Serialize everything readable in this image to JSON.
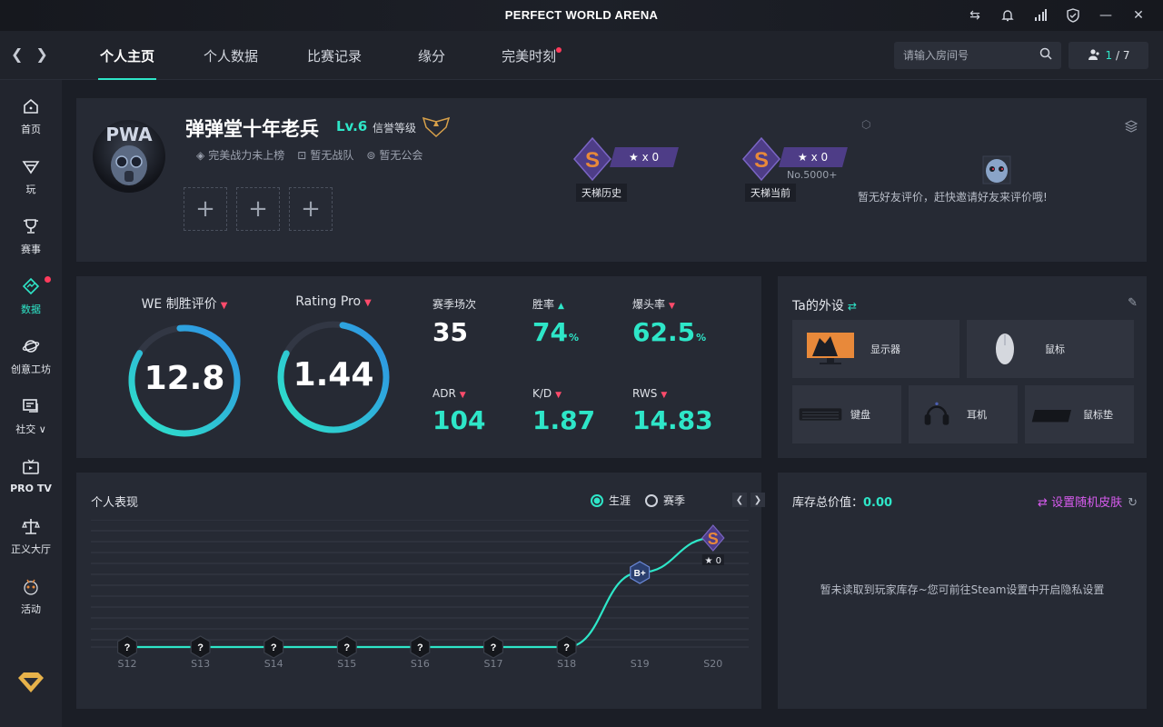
{
  "window": {
    "title": "PERFECT WORLD ARENA"
  },
  "nav": {
    "tabs": [
      {
        "label": "个人主页"
      },
      {
        "label": "个人数据"
      },
      {
        "label": "比赛记录"
      },
      {
        "label": "缘分"
      },
      {
        "label": "完美时刻"
      }
    ],
    "search_placeholder": "请输入房间号",
    "room_current": "1",
    "room_total": "/ 7"
  },
  "sidebar": {
    "items": [
      {
        "label": "首页",
        "icon": "home-icon"
      },
      {
        "label": "玩",
        "icon": "play-icon"
      },
      {
        "label": "赛事",
        "icon": "trophy-icon"
      },
      {
        "label": "数据",
        "icon": "data-icon"
      },
      {
        "label": "创意工坊",
        "icon": "workshop-icon"
      },
      {
        "label": "社交 ∨",
        "icon": "social-icon"
      },
      {
        "label": "PRO TV",
        "icon": "tv-icon"
      },
      {
        "label": "正义大厅",
        "icon": "justice-icon"
      },
      {
        "label": "活动",
        "icon": "event-icon"
      }
    ]
  },
  "profile": {
    "avatar_text": "PWA",
    "name": "弹弹堂十年老兵",
    "level": "Lv.6",
    "credit_label": "信誉等级",
    "tags": [
      "完美战力未上榜",
      "暂无战队",
      "暂无公会"
    ],
    "rank_history": {
      "stars": "★ x 0",
      "caption": "天梯历史"
    },
    "rank_current": {
      "stars": "★ x 0",
      "no": "No.5000+",
      "caption": "天梯当前"
    },
    "friend_note": "暂无好友评价，赶快邀请好友来评价哦!"
  },
  "stats": {
    "we": {
      "label": "WE 制胜评价",
      "value": "12.8"
    },
    "rating": {
      "label": "Rating Pro",
      "value": "1.44"
    },
    "cells": [
      {
        "key": "赛季场次",
        "value": "35",
        "pct": ""
      },
      {
        "key": "胜率",
        "value": "74",
        "pct": "%"
      },
      {
        "key": "爆头率",
        "value": "62.5",
        "pct": "%"
      },
      {
        "key": "ADR",
        "value": "104",
        "pct": ""
      },
      {
        "key": "K/D",
        "value": "1.87",
        "pct": ""
      },
      {
        "key": "RWS",
        "value": "14.83",
        "pct": ""
      }
    ]
  },
  "gear": {
    "title": "Ta的外设",
    "items": [
      "显示器",
      "鼠标",
      "键盘",
      "耳机",
      "鼠标垫"
    ]
  },
  "performance": {
    "title": "个人表现",
    "radio_career": "生涯",
    "radio_season": "赛季",
    "end_badge": "★ 0"
  },
  "chart_data": {
    "type": "line",
    "categories": [
      "S12",
      "S13",
      "S14",
      "S15",
      "S16",
      "S17",
      "S18",
      "S19",
      "S20"
    ],
    "series": [
      {
        "labels": [
          "?",
          "?",
          "?",
          "?",
          "?",
          "?",
          "?",
          "B+",
          "S"
        ]
      }
    ],
    "grid": true
  },
  "inventory": {
    "label": "库存总价值：",
    "value": "0.00",
    "random_skin": "设置随机皮肤",
    "empty_note": "暂未读取到玩家库存~您可前往Steam设置中开启隐私设置"
  },
  "colors": {
    "accent": "#2ee6c8",
    "alert": "#ff3b5c",
    "rank_purple": "#4e3d87",
    "rank_orange": "#e8893a"
  }
}
